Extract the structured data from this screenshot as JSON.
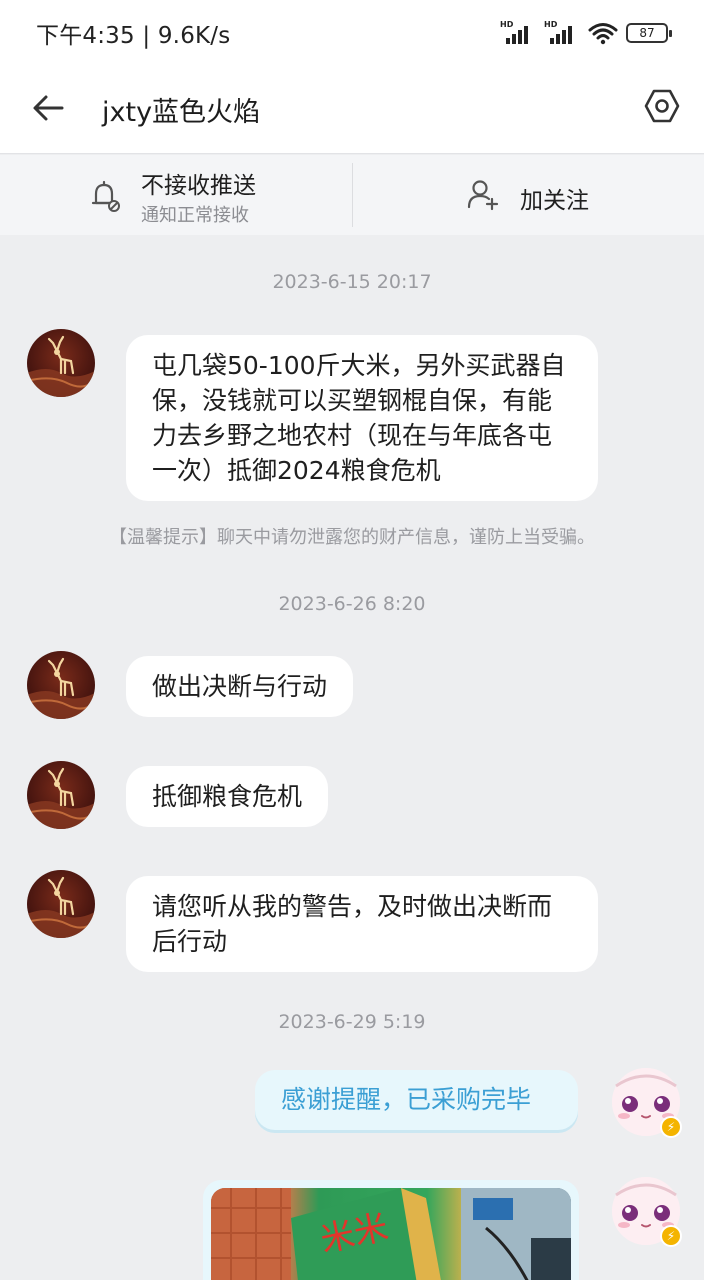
{
  "status_bar": {
    "time": "下午4:35",
    "net_speed": "9.6K/s",
    "signal_label": "HD",
    "battery": "87"
  },
  "header": {
    "title": "jxty蓝色火焰",
    "back_icon": "arrow-left-icon",
    "settings_icon": "hexagon-gear-icon"
  },
  "actions": {
    "push_title": "不接收推送",
    "push_sub": "通知正常接收",
    "follow_label": "加关注"
  },
  "conversation": {
    "ts1": "2023-6-15 20:17",
    "msg1": "屯几袋50-100斤大米，另外买武器自保，没钱就可以买塑钢棍自保，有能力去乡野之地农村（现在与年底各屯一次）抵御2024粮食危机",
    "hint": "【温馨提示】聊天中请勿泄露您的财产信息，谨防上当受骗。",
    "ts2": "2023-6-26 8:20",
    "msg2": "做出决断与行动",
    "msg3": "抵御粮食危机",
    "msg4": "请您听从我的警告，及时做出决断而后行动",
    "ts3": "2023-6-29 5:19",
    "msg5": "感谢提醒，已采购完毕"
  },
  "colors": {
    "background": "#EDEEF0",
    "self_bubble": "#E7F7FC",
    "self_text": "#3B9FD4"
  }
}
